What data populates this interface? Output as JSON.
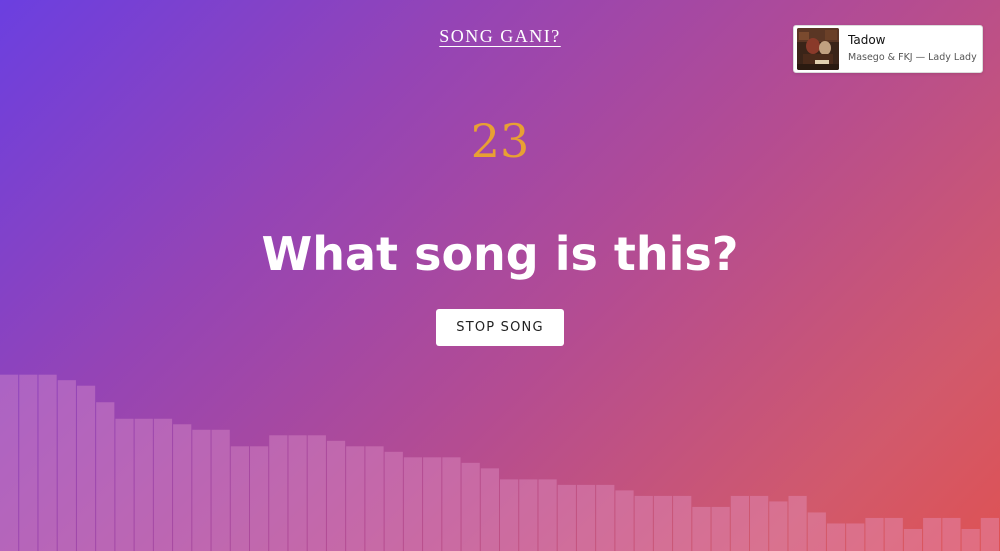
{
  "header": {
    "title": "SONG GANI?"
  },
  "now_playing": {
    "track_title": "Tadow",
    "track_subtitle": "Masego & FKJ — Lady Lady",
    "art_icon": "album-cover-photo"
  },
  "game": {
    "countdown": "23",
    "question": "What song is this?",
    "stop_button_label": "STOP SONG"
  },
  "visualizer": {
    "bar_color": "#e8a0d2",
    "bar_levels": [
      0.32,
      0.32,
      0.32,
      0.31,
      0.3,
      0.27,
      0.24,
      0.24,
      0.24,
      0.23,
      0.22,
      0.22,
      0.19,
      0.19,
      0.21,
      0.21,
      0.21,
      0.2,
      0.19,
      0.19,
      0.18,
      0.17,
      0.17,
      0.17,
      0.16,
      0.15,
      0.13,
      0.13,
      0.13,
      0.12,
      0.12,
      0.12,
      0.11,
      0.1,
      0.1,
      0.1,
      0.08,
      0.08,
      0.1,
      0.1,
      0.09,
      0.1,
      0.07,
      0.05,
      0.05,
      0.06,
      0.06,
      0.04,
      0.06,
      0.06,
      0.04,
      0.06
    ]
  }
}
